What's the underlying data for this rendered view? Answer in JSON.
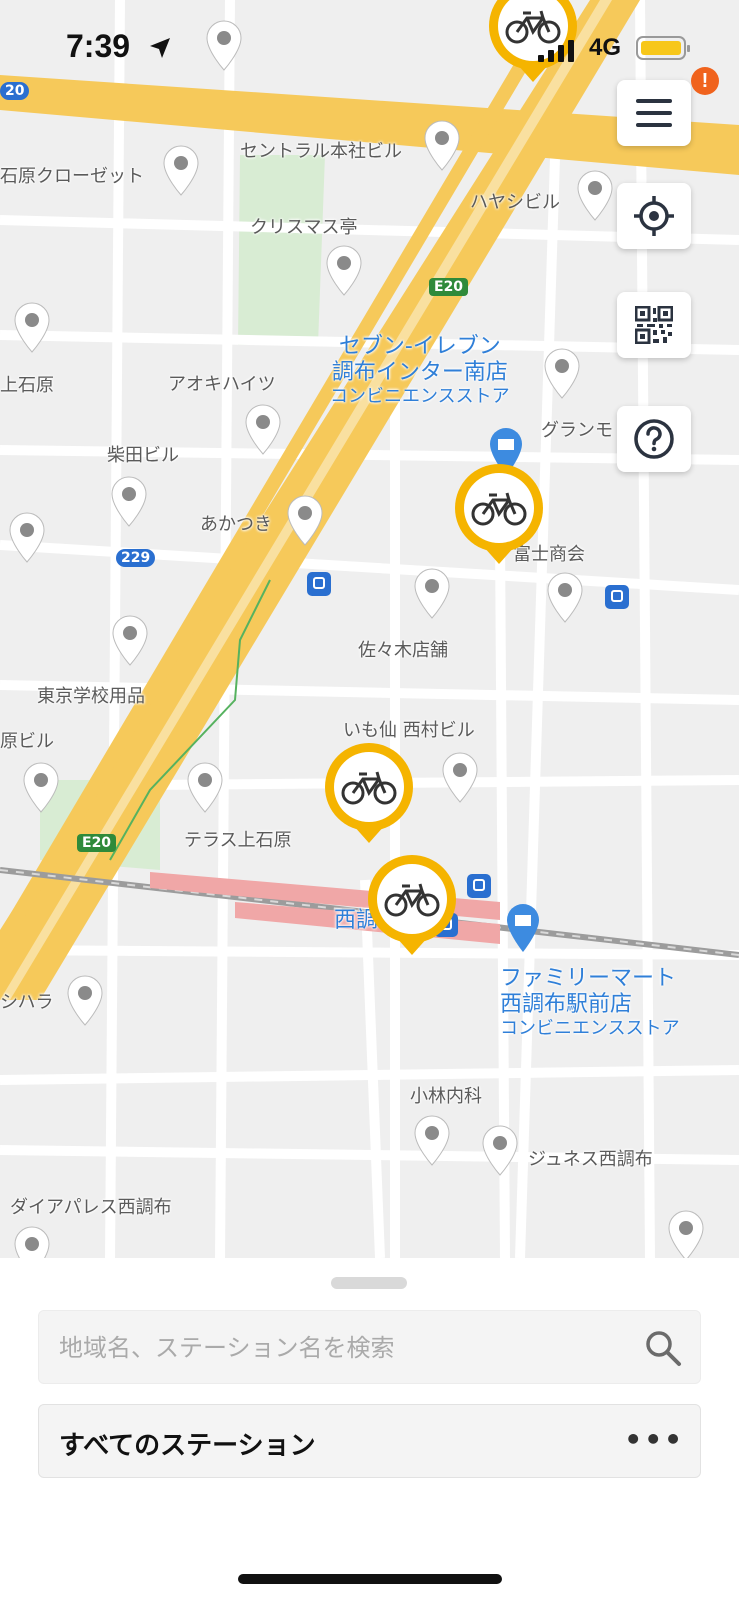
{
  "status_bar": {
    "time": "7:39",
    "network": "4G"
  },
  "map": {
    "place_labels": [
      "セントラル本社ビル",
      "石原クローゼット",
      "クリスマス亭",
      "ハヤシビル",
      "上石原",
      "アオキハイツ",
      "柴田ビル",
      "あかつき",
      "グランモ",
      "富士商会",
      "佐々木店舗",
      "東京学校用品",
      "原ビル",
      "いも仙 西村ビル",
      "テラス上石原",
      "西調",
      "シハラ",
      "小林内科",
      "ジュネス西調布",
      "ダイアパレス西調布"
    ],
    "poi": [
      {
        "name_line1": "セブン-イレブン",
        "name_line2": "調布インター南店",
        "category": "コンビニエンスストア"
      },
      {
        "name_line1": "ファミリーマート",
        "name_line2": "西調布駅前店",
        "category": "コンビニエンスストア"
      }
    ],
    "road_signs": [
      "20",
      "E20",
      "229",
      "E20"
    ]
  },
  "controls": {
    "menu_icon": "hamburger-menu-icon",
    "locate_icon": "crosshair-locate-icon",
    "qr_icon": "qr-code-icon",
    "help_icon": "help-question-icon",
    "alert_badge": "!"
  },
  "colors": {
    "accent": "#f5b400",
    "alert": "#f0631d",
    "poi_blue": "#2f7fd8"
  },
  "bottom_sheet": {
    "search_placeholder": "地域名、ステーション名を検索",
    "search_value": "",
    "all_stations_label": "すべてのステーション",
    "more_label": "•••"
  }
}
